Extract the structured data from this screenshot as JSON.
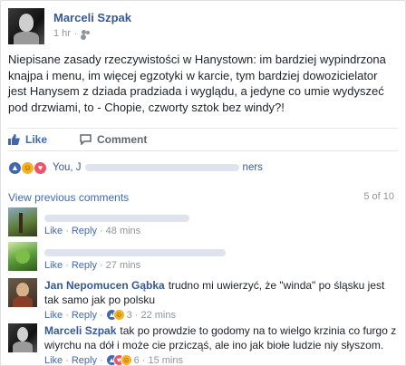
{
  "post": {
    "author": "Marceli Szpak",
    "time": "1 hr",
    "dot": "·",
    "text": "Niepisane zasady rzeczywistości w Hanystown: im bardziej wypindrzona knajpa i menu, im więcej egzotyki w karcie, tym bardziej dowozicielator jest Hanysem z dziada pradziada i wyglądu, a jedyne co umie wydyszeć pod drzwiami, to - Chopie, czworty sztok bez windy?!"
  },
  "actions": {
    "like": "Like",
    "comment": "Comment"
  },
  "reactions": {
    "prefix": "You, J",
    "suffix": "ners"
  },
  "comments_header": {
    "view_previous": "View previous comments",
    "count": "5 of 10"
  },
  "comments": [
    {
      "name": "",
      "text": "",
      "like": "Like",
      "reply": "Reply",
      "time": "48 mins"
    },
    {
      "name": "",
      "text": "",
      "like": "Like",
      "reply": "Reply",
      "time": "27 mins"
    },
    {
      "name": "Jan Nepomucen Gąbka",
      "text": "trudno mi uwierzyć, że \"winda\" po śląsku jest tak samo jak po polsku",
      "like": "Like",
      "reply": "Reply",
      "reaction_count": "3",
      "time": "22 mins"
    },
    {
      "name": "Marceli Szpak",
      "text": "tak po prowdzie to godomy na to wielgo krzinia co furgo z wiyrchu na dół i może cie przicząś, ale ino jak biołe ludzie niy słyszom.",
      "like": "Like",
      "reply": "Reply",
      "reaction_count": "6",
      "time": "15 mins"
    }
  ],
  "colors": {
    "link": "#365899",
    "accent": "#4267b2",
    "muted": "#90949c"
  }
}
